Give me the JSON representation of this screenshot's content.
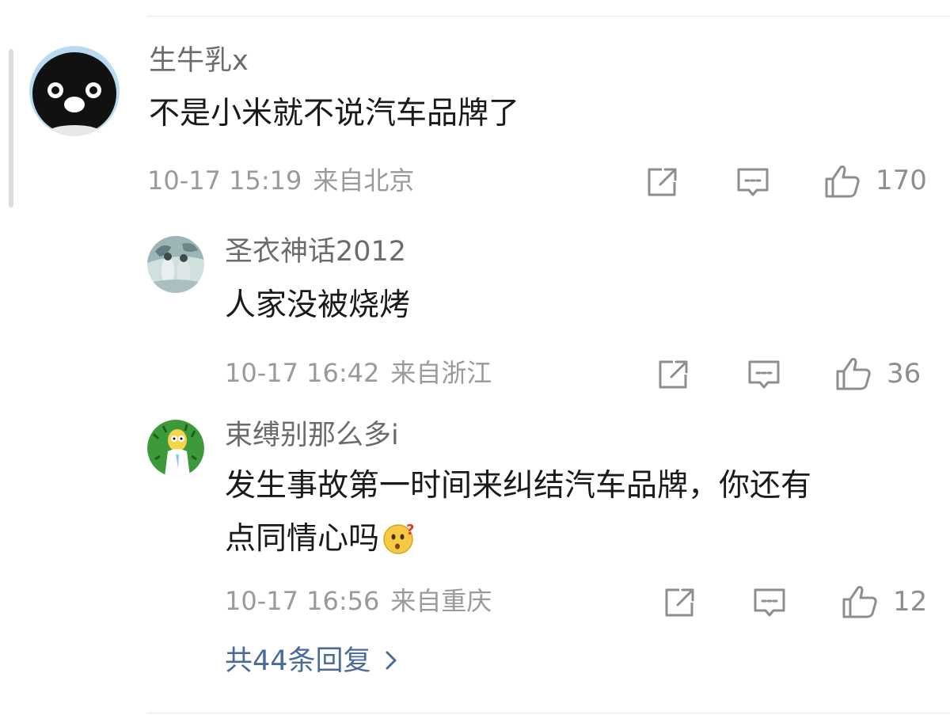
{
  "comments": [
    {
      "username": "生牛乳x",
      "text": "不是小米就不说汽车品牌了",
      "date": "10-17 15:19",
      "location": "来自北京",
      "likes": "170",
      "avatar_icon": "penguin-avatar"
    },
    {
      "username": "圣衣神话2012",
      "text": "人家没被烧烤",
      "date": "10-17 16:42",
      "location": "来自浙江",
      "likes": "36",
      "avatar_icon": "painting-avatar"
    },
    {
      "username": "束缚别那么多i",
      "text_line1": "发生事故第一时间来纠结汽车品牌，你还有",
      "text_line2": "点同情心吗",
      "emoji": "thinking-question-emoji",
      "date": "10-17 16:56",
      "location": "来自重庆",
      "likes": "12",
      "avatar_icon": "cartoon-avatar"
    }
  ],
  "more_replies": "共44条回复",
  "colors": {
    "username": "#6b6b6b",
    "text": "#1a1a1a",
    "meta": "#9a9a9a",
    "link": "#4a6a9c",
    "icon": "#8e8e8e"
  }
}
